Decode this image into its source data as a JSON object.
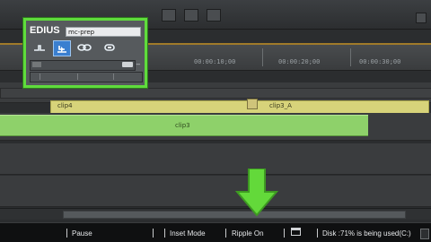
{
  "panel": {
    "title": "EDIUS",
    "preset_name": "mc-prep",
    "icons": [
      "track-icon",
      "ripple-select-icon",
      "link-icon",
      "sync-lock-icon"
    ]
  },
  "ruler": {
    "timecodes": [
      "00:00:10;00",
      "00:00:20;00",
      "00:00:30;00",
      "00:00:40;00"
    ]
  },
  "clips": {
    "video_label": "clip4",
    "audio_label_1": "clip3",
    "audio_label_2": "clip3_A"
  },
  "status": {
    "play_state": "Pause",
    "edit_mode": "Inset Mode",
    "ripple": "Ripple On",
    "disk": "Disk :71% is being used(C:)"
  },
  "colors": {
    "highlight": "#5fdc3c",
    "video_clip": "#d7d37a",
    "audio_clip": "#8ed16a",
    "status_bg": "#0f1011"
  }
}
